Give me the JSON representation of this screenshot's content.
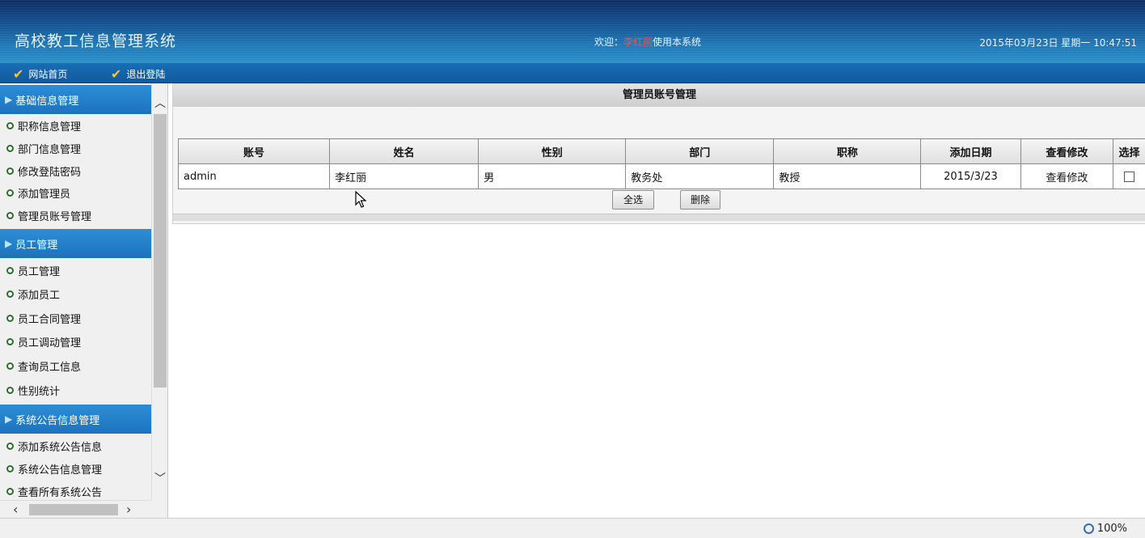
{
  "header": {
    "app_title": "高校教工信息管理系统",
    "welcome_prefix": "欢迎：",
    "welcome_user": "李红丽",
    "welcome_suffix": "使用本系统",
    "datetime": "2015年03月23日 星期一 10:47:51"
  },
  "nav": {
    "home": "网站首页",
    "logout": "退出登陆"
  },
  "sidebar": {
    "sections": [
      {
        "title": "基础信息管理",
        "items": [
          "职称信息管理",
          "部门信息管理",
          "修改登陆密码",
          "添加管理员",
          "管理员账号管理"
        ]
      },
      {
        "title": "员工管理",
        "items": [
          "员工管理",
          "添加员工",
          "员工合同管理",
          "员工调动管理",
          "查询员工信息",
          "性别统计"
        ]
      },
      {
        "title": "系统公告信息管理",
        "items": [
          "添加系统公告信息",
          "系统公告信息管理",
          "查看所有系统公告"
        ]
      }
    ]
  },
  "main": {
    "panel_title": "管理员账号管理",
    "columns": [
      "账号",
      "姓名",
      "性别",
      "部门",
      "职称",
      "添加日期",
      "查看修改",
      "选择"
    ],
    "rows": [
      {
        "account": "admin",
        "name": "李红丽",
        "gender": "男",
        "dept": "教务处",
        "title": "教授",
        "date": "2015/3/23",
        "action": "查看修改",
        "selected": false
      }
    ],
    "select_all_label": "全选",
    "delete_label": "删除"
  },
  "statusbar": {
    "zoom": "100%"
  },
  "colors": {
    "header_dark": "#0b2b63",
    "header_light": "#2b8fc8",
    "section_blue": "#1d72bd",
    "welcome_user": "#ff4b4b",
    "check_icon": "#f4c534"
  }
}
